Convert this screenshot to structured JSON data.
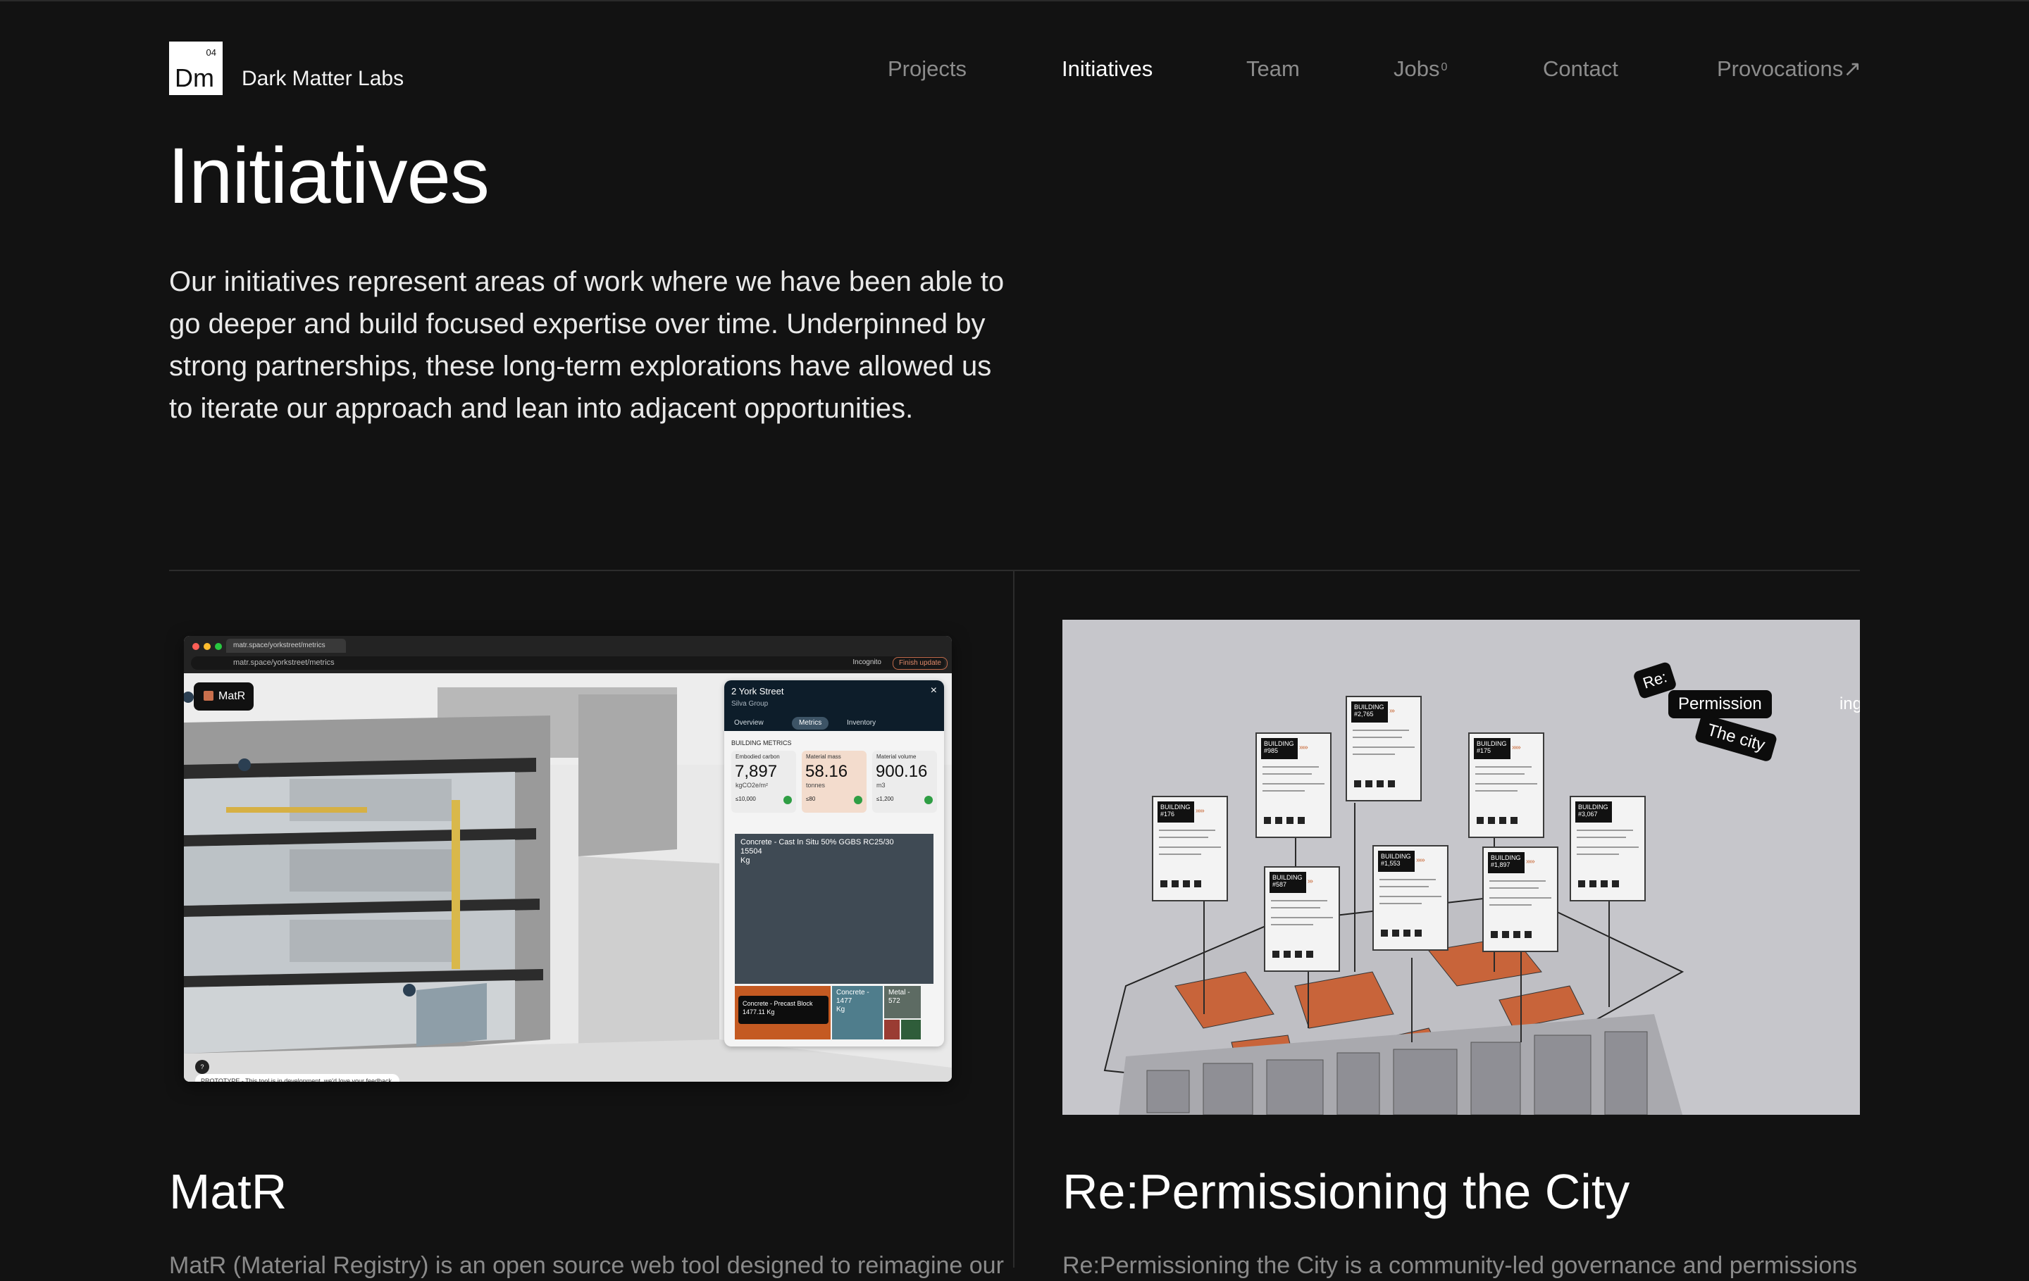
{
  "brand": {
    "logo_mark": "Dm",
    "logo_sup": "04",
    "name": "Dark Matter Labs"
  },
  "nav": [
    {
      "label": "Projects",
      "active": false
    },
    {
      "label": "Initiatives",
      "active": true
    },
    {
      "label": "Team",
      "active": false
    },
    {
      "label": "Jobs",
      "sup": "0",
      "active": false
    },
    {
      "label": "Contact",
      "active": false
    },
    {
      "label": "Provocations↗",
      "active": false
    }
  ],
  "hero": {
    "title": "Initiatives",
    "intro_lines": [
      "Our initiatives represent areas of work where we have been able to",
      "go deeper and build focused expertise over time. Underpinned by",
      "strong partnerships, these long-term explorations have allowed us",
      "to iterate our approach and lean into adjacent opportunities."
    ]
  },
  "cards": [
    {
      "title": "MatR",
      "description": "MatR (Material Registry) is an open source web tool designed to reimagine our",
      "screenshot": {
        "tab_label": "matr.space/yorkstreet/metrics",
        "url": "matr.space/yorkstreet/metrics",
        "incognito": "Incognito",
        "finish_update": "Finish update",
        "app_badge": "MatR",
        "prototype_note": "PROTOTYPE - This tool is in development, we'd love your feedback.",
        "help": "?",
        "panel": {
          "title": "2 York Street",
          "subtitle": "Silva Group",
          "close": "×",
          "tabs": [
            "Overview",
            "Metrics",
            "Inventory"
          ],
          "active_tab": "Metrics",
          "section_label": "BUILDING METRICS",
          "metrics": [
            {
              "label": "Embodied carbon",
              "value": "7,897",
              "unit": "kgCO2e/m²",
              "target": "≤10,000",
              "target_unit": "kgCO2e/m²",
              "color": "#e4e4e4"
            },
            {
              "label": "Material mass",
              "value": "58.16",
              "unit": "tonnes",
              "target": "≤80",
              "target_unit": "tonnes",
              "color": "#f3dccd"
            },
            {
              "label": "Material volume",
              "value": "900.16",
              "unit": "m3",
              "target": "≤1,200",
              "target_unit": "m3",
              "color": "#e4e4e4"
            }
          ],
          "treemap": {
            "main": {
              "label": "Concrete - Cast In Situ 50% GGBS RC25/30",
              "value": "15504",
              "unit": "Kg"
            },
            "b": {
              "label": "Concrete -",
              "value": "1477",
              "unit": "Kg"
            },
            "c": {
              "label": "Metal -",
              "value": "572"
            },
            "tooltip": {
              "label": "Concrete - Precast Block",
              "value": "1477.11 Kg"
            }
          }
        }
      }
    },
    {
      "title": "Re:Permissioning the City",
      "description": "Re:Permissioning the City is a community-led governance and permissions",
      "illustration": {
        "stickers": [
          "Re:",
          "Permission",
          "ing",
          "The city"
        ],
        "buildings": [
          "BUILDING #176",
          "BUILDING #985",
          "BUILDING #2,765",
          "BUILDING #587",
          "BUILDING #1,553",
          "BUILDING #175",
          "BUILDING #1,897",
          "BUILDING #3,067"
        ],
        "accent_color": "#c8643a"
      }
    }
  ]
}
